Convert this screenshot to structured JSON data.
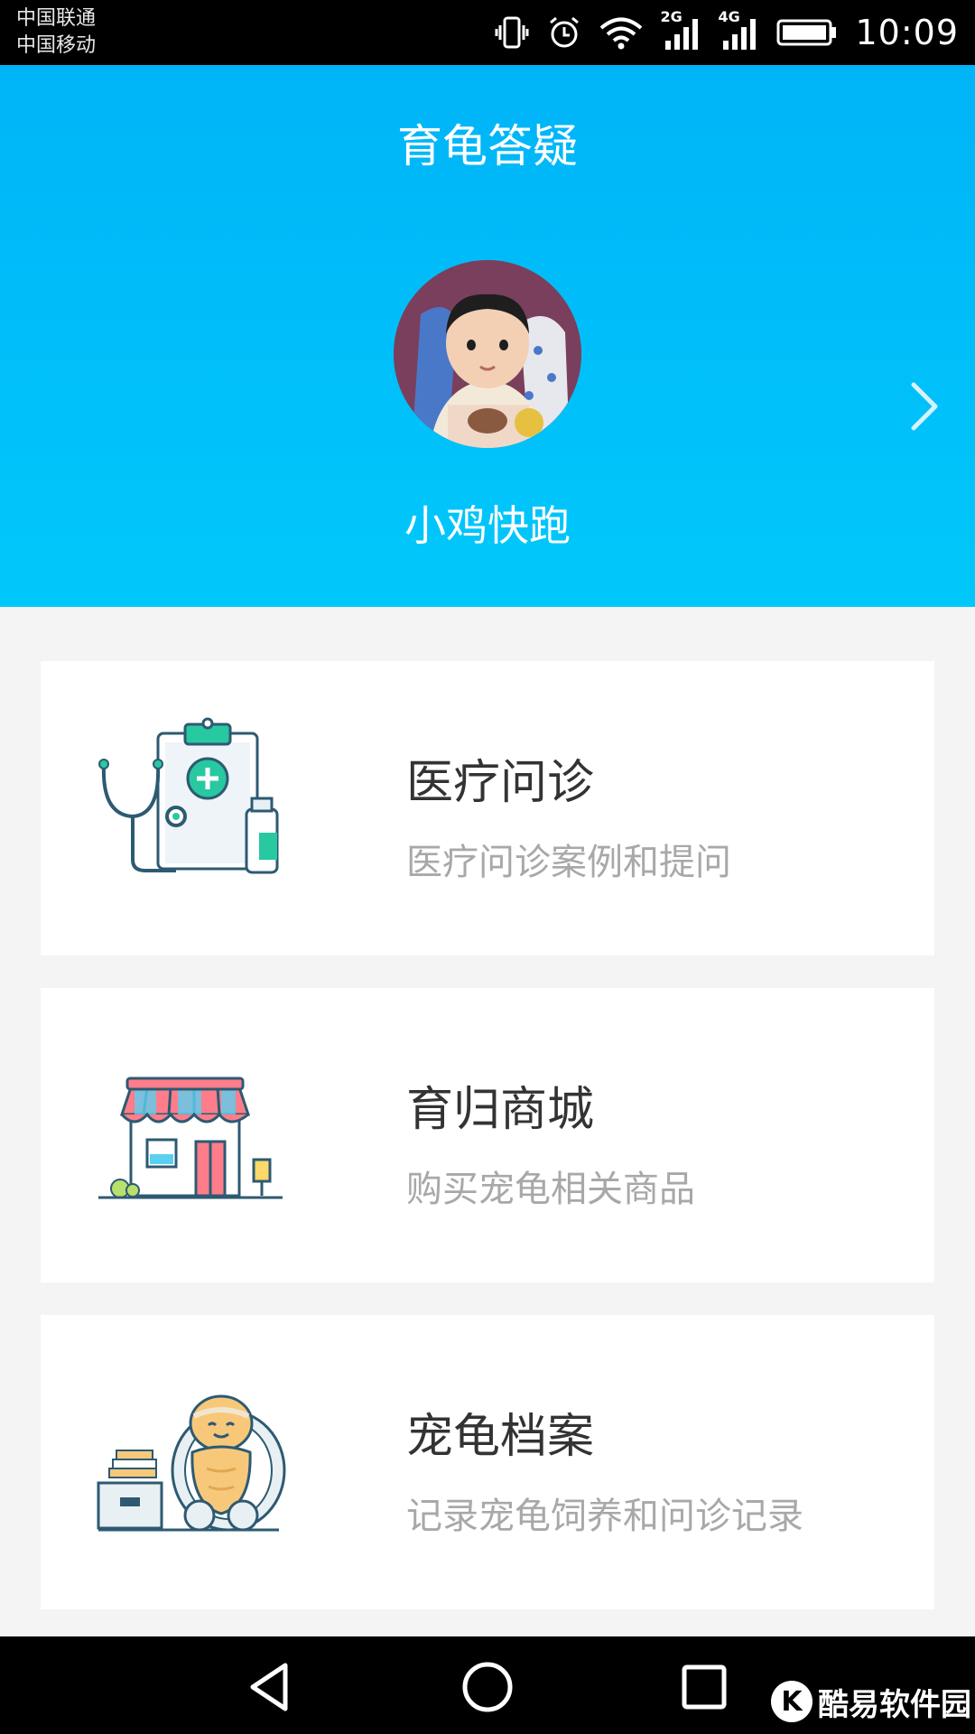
{
  "status_bar": {
    "carrier_1": "中国联通",
    "carrier_2": "中国移动",
    "net_2g": "2G",
    "net_4g": "4G",
    "time": "10:09",
    "icons": [
      "vibrate-icon",
      "alarm-icon",
      "wifi-icon",
      "signal-icon",
      "signal-icon",
      "battery-icon"
    ]
  },
  "header": {
    "title": "育龟答疑",
    "username": "小鸡快跑",
    "colors": {
      "gradient_top": "#00b4f8",
      "gradient_bottom": "#00c8fa"
    }
  },
  "cards": [
    {
      "title": "医疗问诊",
      "subtitle": "医疗问诊案例和提问",
      "icon": "medical-clipboard-icon"
    },
    {
      "title": "育归商城",
      "subtitle": "购买宠龟相关商品",
      "icon": "shop-icon"
    },
    {
      "title": "宠龟档案",
      "subtitle": "记录宠龟饲养和问诊记录",
      "icon": "turtle-archive-icon"
    }
  ],
  "nav_bar": {
    "icons": [
      "back-icon",
      "home-icon",
      "recent-apps-icon"
    ]
  },
  "watermark": {
    "logo_letter": "K",
    "text": "酷易软件园"
  }
}
